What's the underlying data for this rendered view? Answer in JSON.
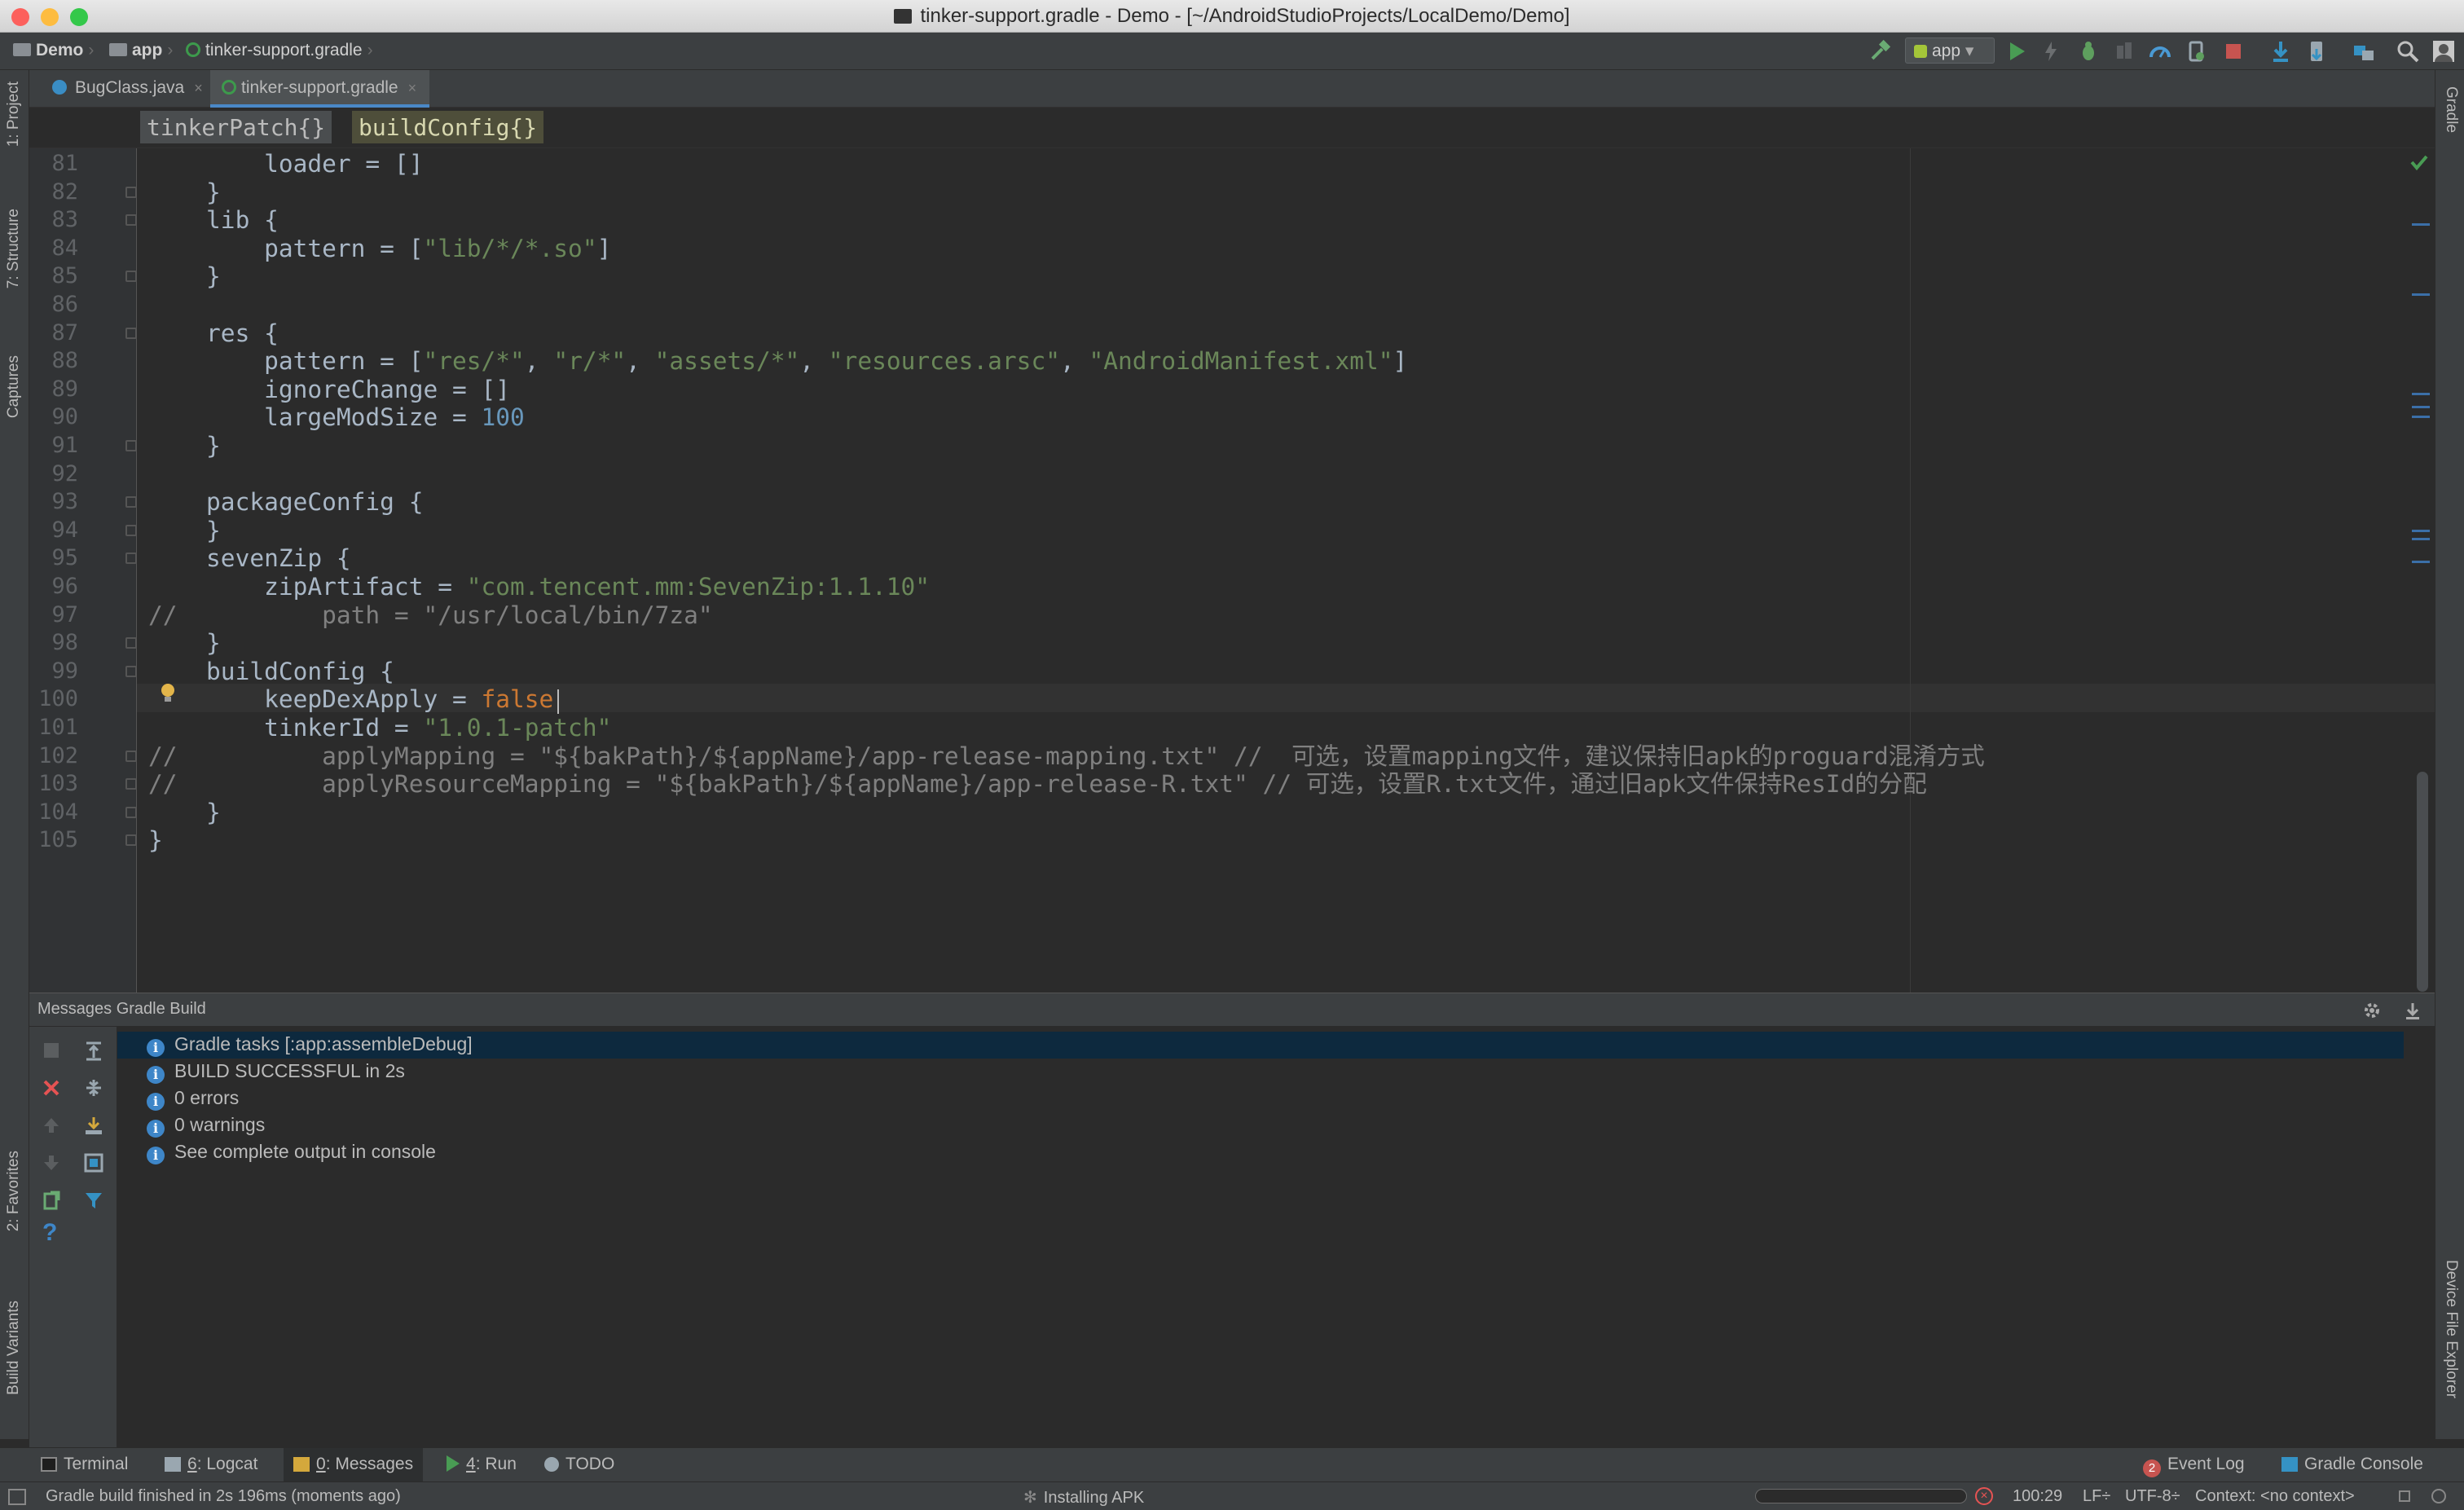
{
  "window": {
    "title": "tinker-support.gradle - Demo - [~/AndroidStudioProjects/LocalDemo/Demo]"
  },
  "navbar": {
    "crumbs": [
      "Demo",
      "app",
      "tinker-support.gradle"
    ],
    "run_config": "app"
  },
  "tabs": [
    {
      "label": "BugClass.java",
      "active": false
    },
    {
      "label": "tinker-support.gradle",
      "active": true
    }
  ],
  "editor_breadcrumbs": [
    "tinkerPatch{}",
    "buildConfig{}"
  ],
  "editor": {
    "line_numbers": [
      "81",
      "82",
      "83",
      "84",
      "85",
      "86",
      "87",
      "88",
      "89",
      "90",
      "91",
      "92",
      "93",
      "94",
      "95",
      "96",
      "97",
      "98",
      "99",
      "100",
      "101",
      "102",
      "103",
      "104",
      "105"
    ],
    "lines": [
      "        loader = []",
      "    }",
      "    lib {",
      "        pattern = [\"lib/*/*.so\"]",
      "    }",
      "",
      "    res {",
      "        pattern = [\"res/*\", \"r/*\", \"assets/*\", \"resources.arsc\", \"AndroidManifest.xml\"]",
      "        ignoreChange = []",
      "        largeModSize = 100",
      "    }",
      "",
      "    packageConfig {",
      "    }",
      "    sevenZip {",
      "        zipArtifact = \"com.tencent.mm:SevenZip:1.1.10\"",
      "//          path = \"/usr/local/bin/7za\"",
      "    }",
      "    buildConfig {",
      "        keepDexApply = false",
      "        tinkerId = \"1.0.1-patch\"",
      "//          applyMapping = \"${bakPath}/${appName}/app-release-mapping.txt\" //  可选，设置mapping文件，建议保持旧apk的proguard混淆方式",
      "//          applyResourceMapping = \"${bakPath}/${appName}/app-release-R.txt\" // 可选，设置R.txt文件，通过旧apk文件保持ResId的分配",
      "    }",
      "}"
    ],
    "caret_line": "100"
  },
  "left_tools": [
    "1: Project",
    "7: Structure",
    "Captures",
    "2: Favorites",
    "Build Variants"
  ],
  "right_tools": [
    "Gradle",
    "Device File Explorer"
  ],
  "messages": {
    "header": "Messages Gradle Build",
    "items": [
      "Gradle tasks [:app:assembleDebug]",
      "BUILD SUCCESSFUL in 2s",
      "0 errors",
      "0 warnings",
      "See complete output in console"
    ]
  },
  "bottom_tabs": {
    "terminal": "Terminal",
    "logcat_num": "6",
    "logcat": ": Logcat",
    "messages_num": "0",
    "messages": ": Messages",
    "run_num": "4",
    "run": ": Run",
    "todo": "TODO",
    "event_log_count": "2",
    "event_log": "Event Log",
    "gradle_console": "Gradle Console"
  },
  "status": {
    "message": "Gradle build finished in 2s 196ms (moments ago)",
    "progress": "Installing APK",
    "position": "100:29",
    "line_sep": "LF÷",
    "encoding": "UTF-8÷",
    "context": "Context: <no context>"
  },
  "colors": {
    "editor_bg": "#2b2b2b",
    "panel_bg": "#3c3f41",
    "keyword": "#cc7832",
    "string": "#6a8759",
    "number": "#6897bb",
    "selection": "#0d293e"
  }
}
